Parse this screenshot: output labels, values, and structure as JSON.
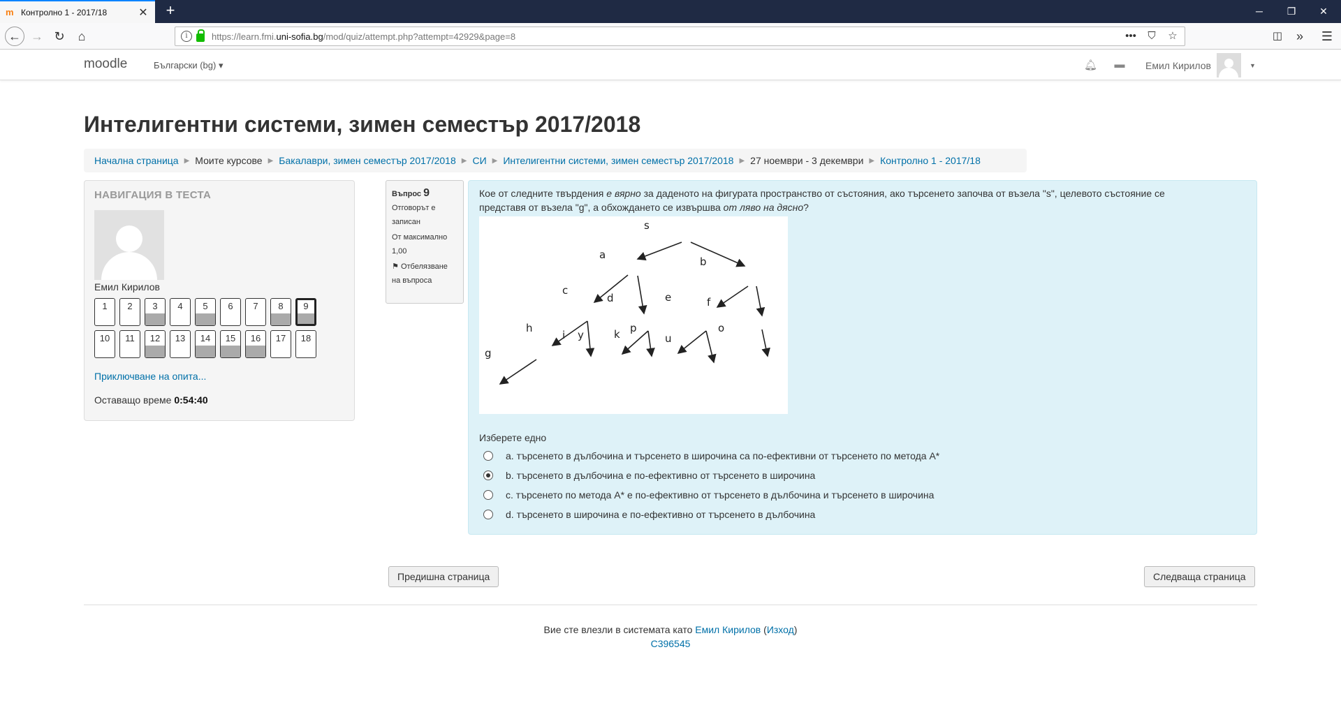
{
  "browser": {
    "tab_title": "Контролно 1 - 2017/18",
    "url_prefix": "https://learn.fmi.",
    "url_domain": "uni-sofia.bg",
    "url_path": "/mod/quiz/attempt.php?attempt=42929&page=8"
  },
  "header": {
    "brand": "moodle",
    "language": "Български (bg)",
    "user_name": "Емил Кирилов"
  },
  "page": {
    "title": "Интелигентни системи, зимен семестър 2017/2018"
  },
  "breadcrumb": [
    {
      "label": "Начална страница",
      "link": true
    },
    {
      "label": "Моите курсове",
      "link": false
    },
    {
      "label": "Бакалаври, зимен семестър 2017/2018",
      "link": true
    },
    {
      "label": "СИ",
      "link": true
    },
    {
      "label": "Интелигентни системи, зимен семестър 2017/2018",
      "link": true
    },
    {
      "label": "27 ноември - 3 декември",
      "link": false
    },
    {
      "label": "Контролно 1 - 2017/18",
      "link": true
    }
  ],
  "quiz_nav": {
    "heading": "НАВИГАЦИЯ В ТЕСТА",
    "user_name": "Емил Кирилов",
    "questions": [
      {
        "n": "1",
        "answered": false,
        "current": false
      },
      {
        "n": "2",
        "answered": false,
        "current": false
      },
      {
        "n": "3",
        "answered": true,
        "current": false
      },
      {
        "n": "4",
        "answered": false,
        "current": false
      },
      {
        "n": "5",
        "answered": true,
        "current": false
      },
      {
        "n": "6",
        "answered": false,
        "current": false
      },
      {
        "n": "7",
        "answered": false,
        "current": false
      },
      {
        "n": "8",
        "answered": true,
        "current": false
      },
      {
        "n": "9",
        "answered": true,
        "current": true
      },
      {
        "n": "10",
        "answered": false,
        "current": false
      },
      {
        "n": "11",
        "answered": false,
        "current": false
      },
      {
        "n": "12",
        "answered": true,
        "current": false
      },
      {
        "n": "13",
        "answered": false,
        "current": false
      },
      {
        "n": "14",
        "answered": true,
        "current": false
      },
      {
        "n": "15",
        "answered": true,
        "current": false
      },
      {
        "n": "16",
        "answered": true,
        "current": false
      },
      {
        "n": "17",
        "answered": false,
        "current": false
      },
      {
        "n": "18",
        "answered": false,
        "current": false
      }
    ],
    "finish_link": "Приключване на опита...",
    "time_label": "Оставащо време",
    "time_value": "0:54:40"
  },
  "question_info": {
    "label": "Въпрос",
    "number": "9",
    "status": "Отговорът е записан",
    "max_mark": "От максимално 1,00",
    "flag": "Отбелязване на въпроса"
  },
  "question": {
    "text_1": "Кое от следните твърдения ",
    "text_em1": "е вярно",
    "text_2": " за даденото на фигурата пространство от състояния, ако търсенето започва от възела \"s\", целевото състояние се представя от възела \"g\", а обхождането се извършва ",
    "text_em2": "от ляво на дясно",
    "text_3": "?",
    "tree_labels": [
      "s",
      "a",
      "b",
      "c",
      "d",
      "e",
      "f",
      "h",
      "i",
      "y",
      "k",
      "p",
      "u",
      "o",
      "g"
    ],
    "prompt": "Изберете едно",
    "options": [
      {
        "label": "a. търсенето в дълбочина и търсенето в широчина са по-ефективни от търсенето по метода А*",
        "checked": false
      },
      {
        "label": "b. търсенето в дълбочина е по-ефективно от търсенето в широчина",
        "checked": true
      },
      {
        "label": "c. търсенето по метода А* е по-ефективно от търсенето в дълбочина и търсенето в широчина",
        "checked": false
      },
      {
        "label": "d. търсенето в широчина е по-ефективно от търсенето в дълбочина",
        "checked": false
      }
    ]
  },
  "buttons": {
    "prev": "Предишна страница",
    "next": "Следваща страница"
  },
  "footer": {
    "logged_in_text": "Вие сте влезли в системата като ",
    "user_link": "Емил Кирилов",
    "logout": "Изход",
    "code": "С396545"
  }
}
